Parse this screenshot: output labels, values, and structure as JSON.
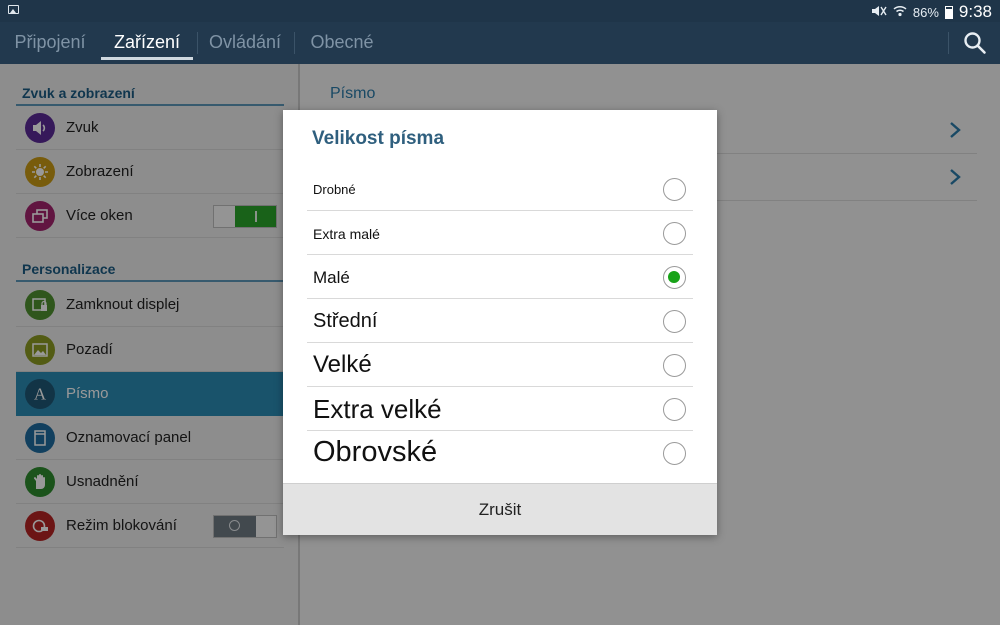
{
  "status_bar": {
    "notification_icon": "gallery-icon",
    "battery_percent": "86%",
    "time": "9:38"
  },
  "tabs": [
    {
      "label": "Připojení",
      "active": false
    },
    {
      "label": "Zařízení",
      "active": true
    },
    {
      "label": "Ovládání",
      "active": false
    },
    {
      "label": "Obecné",
      "active": false
    }
  ],
  "sidebar": {
    "section1": "Zvuk a zobrazení",
    "section2": "Personalizace",
    "items": [
      {
        "label": "Zvuk",
        "icon": "volume-icon",
        "color": "#5a2a96"
      },
      {
        "label": "Zobrazení",
        "icon": "brightness-icon",
        "color": "#c99a14"
      },
      {
        "label": "Více oken",
        "icon": "multi-window-icon",
        "color": "#a2236d",
        "toggle": "on"
      },
      {
        "label": "Zamknout displej",
        "icon": "lock-screen-icon",
        "color": "#4f8f2f"
      },
      {
        "label": "Pozadí",
        "icon": "wallpaper-icon",
        "color": "#8a9a22"
      },
      {
        "label": "Písmo",
        "icon": "font-icon",
        "color": "#2f6f91",
        "active": true
      },
      {
        "label": "Oznamovací panel",
        "icon": "notification-panel-icon",
        "color": "#1f6c9e"
      },
      {
        "label": "Usnadnění",
        "icon": "hand-icon",
        "color": "#2d8a2d"
      },
      {
        "label": "Režim blokování",
        "icon": "block-icon",
        "color": "#b52424",
        "toggle": "off"
      }
    ]
  },
  "right_panel": {
    "heading": "Písmo"
  },
  "dialog": {
    "title": "Velikost písma",
    "options": [
      {
        "label": "Drobné",
        "checked": false
      },
      {
        "label": "Extra malé",
        "checked": false
      },
      {
        "label": "Malé",
        "checked": true
      },
      {
        "label": "Střední",
        "checked": false
      },
      {
        "label": "Velké",
        "checked": false
      },
      {
        "label": "Extra velké",
        "checked": false
      },
      {
        "label": "Obrovské",
        "checked": false
      }
    ],
    "cancel_label": "Zrušit"
  },
  "colors": {
    "action_bar": "#22394e",
    "accent": "#2b8ab2",
    "radio_checked": "#18a318"
  }
}
